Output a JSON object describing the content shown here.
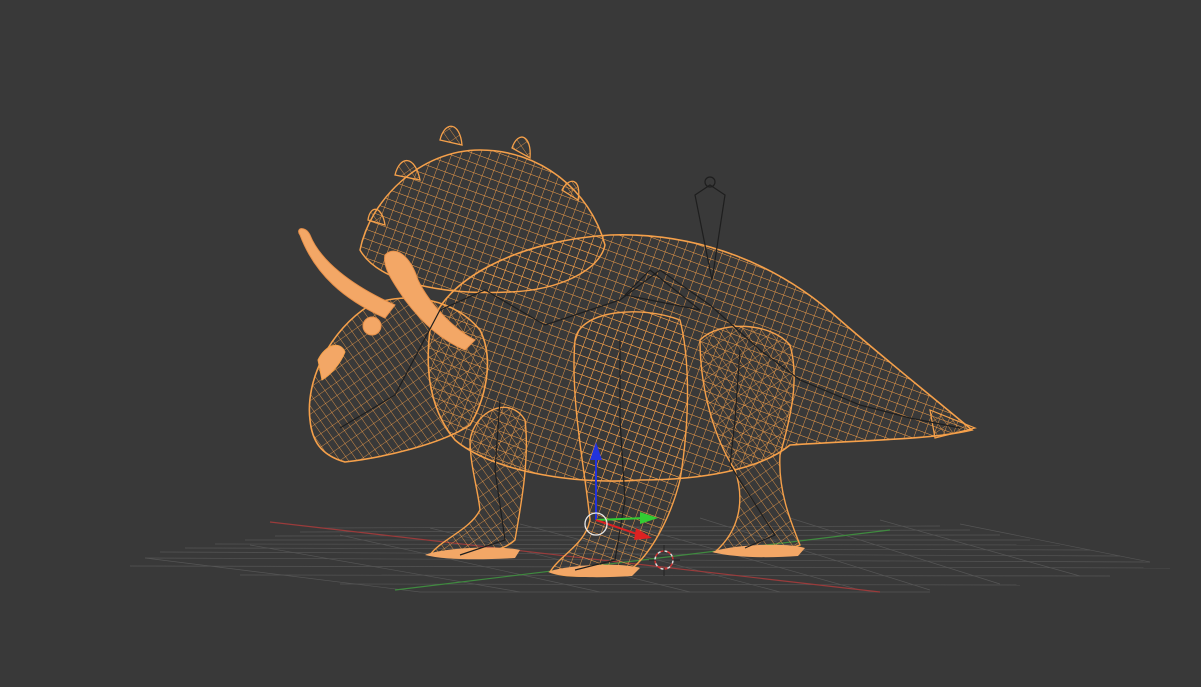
{
  "viewport": {
    "background_color": "#393939",
    "grid_color": "#555555",
    "x_axis_color": "#9a3b3b",
    "y_axis_color": "#3f8a3f",
    "mesh_wire_color": "#f5a04a",
    "mesh_fill_color": "#f3a766",
    "armature_color": "#1e1e1e",
    "gizmo": {
      "z_axis_color": "#2233dd",
      "y_axis_color": "#33cc33",
      "x_axis_color": "#dd2222",
      "center_ring_color": "#e8e8e8"
    },
    "object": "triceratops-mesh-with-armature",
    "display_mode": "wireframe"
  }
}
